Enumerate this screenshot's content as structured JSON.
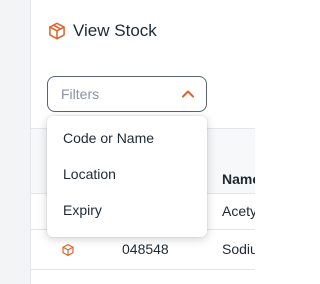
{
  "colors": {
    "accent": "#e0612a",
    "text": "#1f2933",
    "placeholder": "#8a94a3",
    "border": "#5b6474",
    "sidebar_bg": "#f3f4f6"
  },
  "header": {
    "icon": "box-icon",
    "title": "View Stock"
  },
  "filter": {
    "placeholder": "Filters",
    "chevron_icon": "chevron-up-icon",
    "expanded": true,
    "options": [
      "Code or Name",
      "Location",
      "Expiry"
    ]
  },
  "table": {
    "columns": {
      "name": "Name"
    },
    "rows": [
      {
        "code": "",
        "name": "Acety"
      },
      {
        "icon": "box-icon",
        "code": "048548",
        "name": "Sodiu"
      }
    ]
  }
}
